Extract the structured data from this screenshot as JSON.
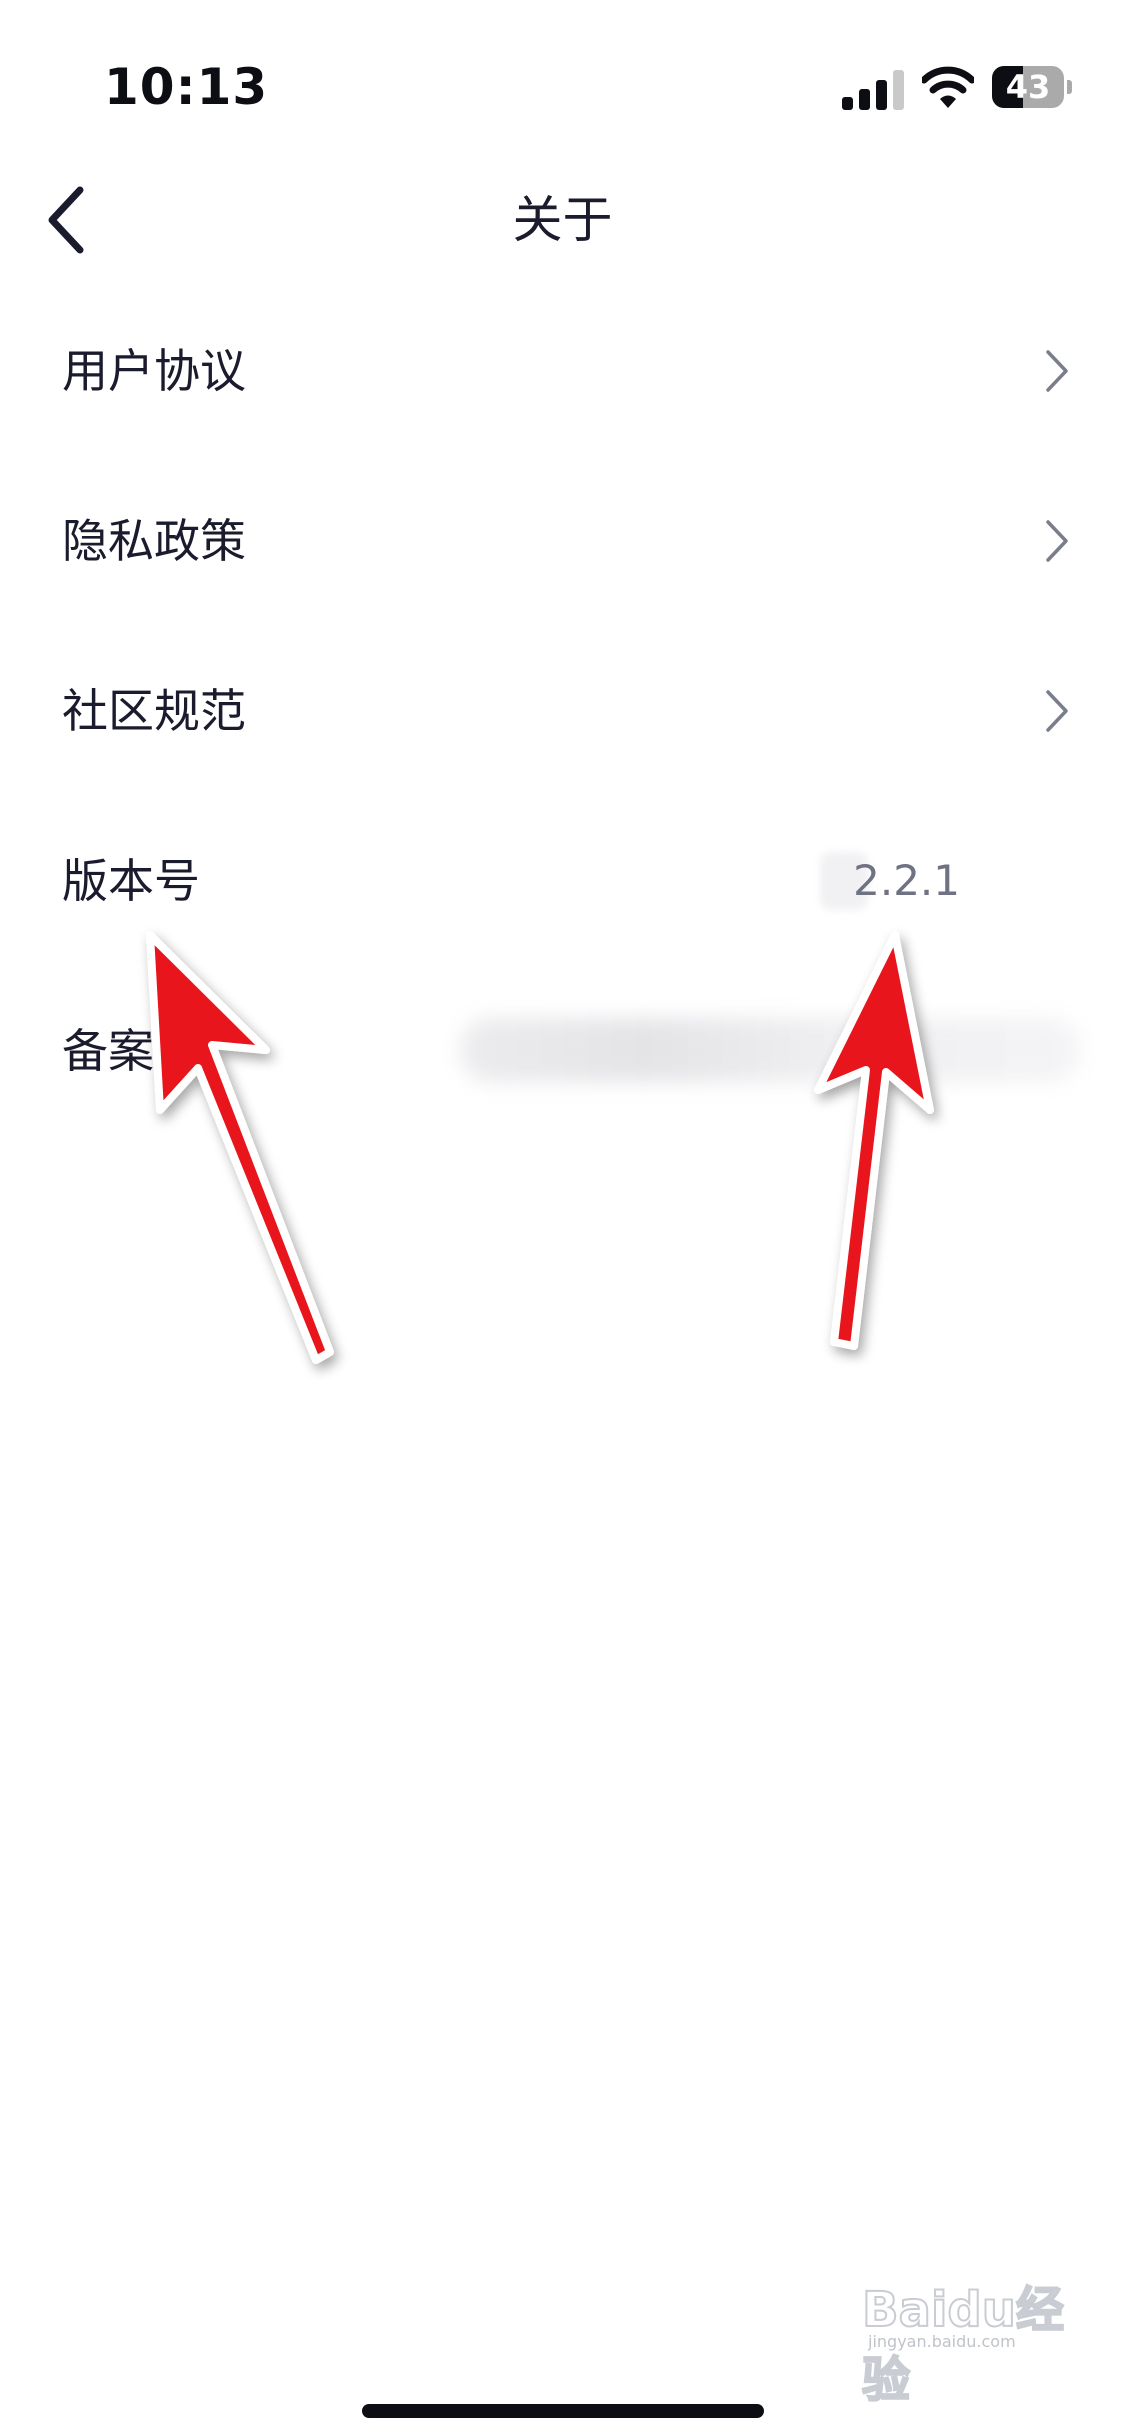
{
  "status_bar": {
    "time": "10:13",
    "battery_level": "43",
    "battery_fraction": 0.43,
    "icons": [
      "cellular-signal-icon",
      "wifi-icon",
      "battery-icon"
    ]
  },
  "nav": {
    "title": "关于",
    "back_icon": "chevron-left-icon"
  },
  "menu": {
    "items": [
      {
        "label": "用户协议",
        "icon": "chevron-right-icon"
      },
      {
        "label": "隐私政策",
        "icon": "chevron-right-icon"
      },
      {
        "label": "社区规范",
        "icon": "chevron-right-icon"
      },
      {
        "label": "版本号",
        "value": "2.2.1"
      },
      {
        "label": "备案"
      }
    ]
  },
  "annotations": {
    "arrow_color": "#e8141a",
    "arrow_count": 2
  },
  "watermark": {
    "logo": "Baidu经验",
    "sub": "jingyan.baidu.com"
  },
  "colors": {
    "text_primary": "#1b1b2e",
    "text_secondary": "#6e7282",
    "background": "#ffffff"
  }
}
